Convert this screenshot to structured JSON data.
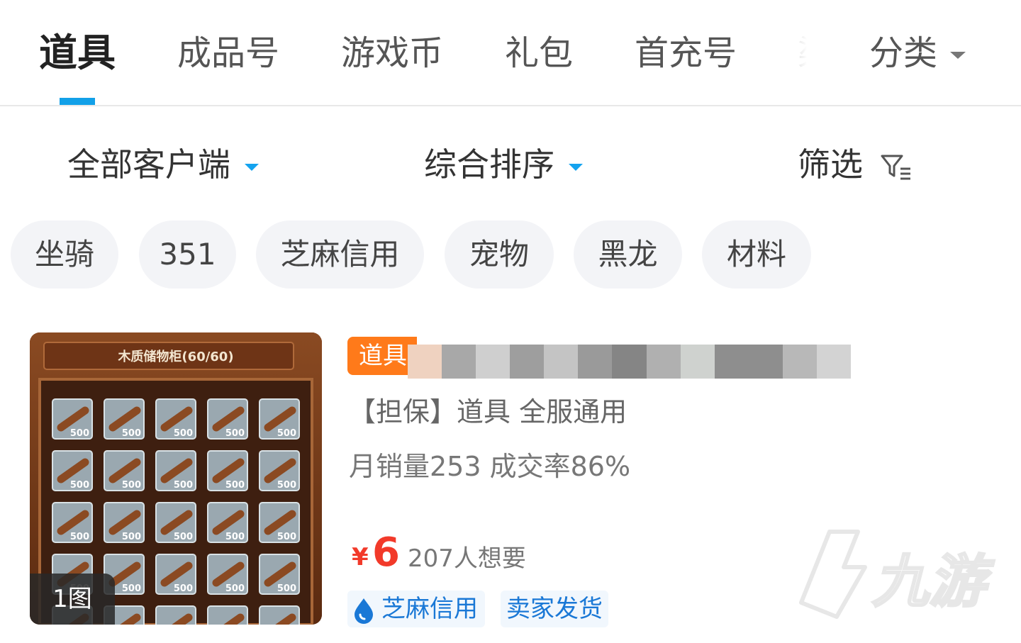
{
  "tabs": [
    {
      "label": "道具",
      "active": true
    },
    {
      "label": "成品号"
    },
    {
      "label": "游戏币"
    },
    {
      "label": "礼包"
    },
    {
      "label": "首充号"
    },
    {
      "label": "渠"
    }
  ],
  "category_menu": {
    "label": "分类"
  },
  "filters": {
    "client": "全部客户端",
    "sort": "综合排序",
    "filter": "筛选"
  },
  "chips": [
    "坐骑",
    "351",
    "芝麻信用",
    "宠物",
    "黑龙",
    "材料"
  ],
  "product": {
    "image_title": "木质储物柜(60/60)",
    "image_slot_label": "500",
    "image_count": "1图",
    "type_tag": "道具",
    "description": "【担保】道具  全服通用",
    "stats": "月销量253 成交率86%",
    "currency": "¥",
    "price": "6",
    "wants": "207人想要",
    "badges": {
      "credit": "芝麻信用",
      "seller": "卖家发货"
    }
  },
  "watermark": {
    "text": "九游"
  },
  "colors": {
    "accent": "#12a0e8",
    "price": "#f23a2a",
    "tag": "#ff7a1a",
    "badge_text": "#1a78d6"
  }
}
